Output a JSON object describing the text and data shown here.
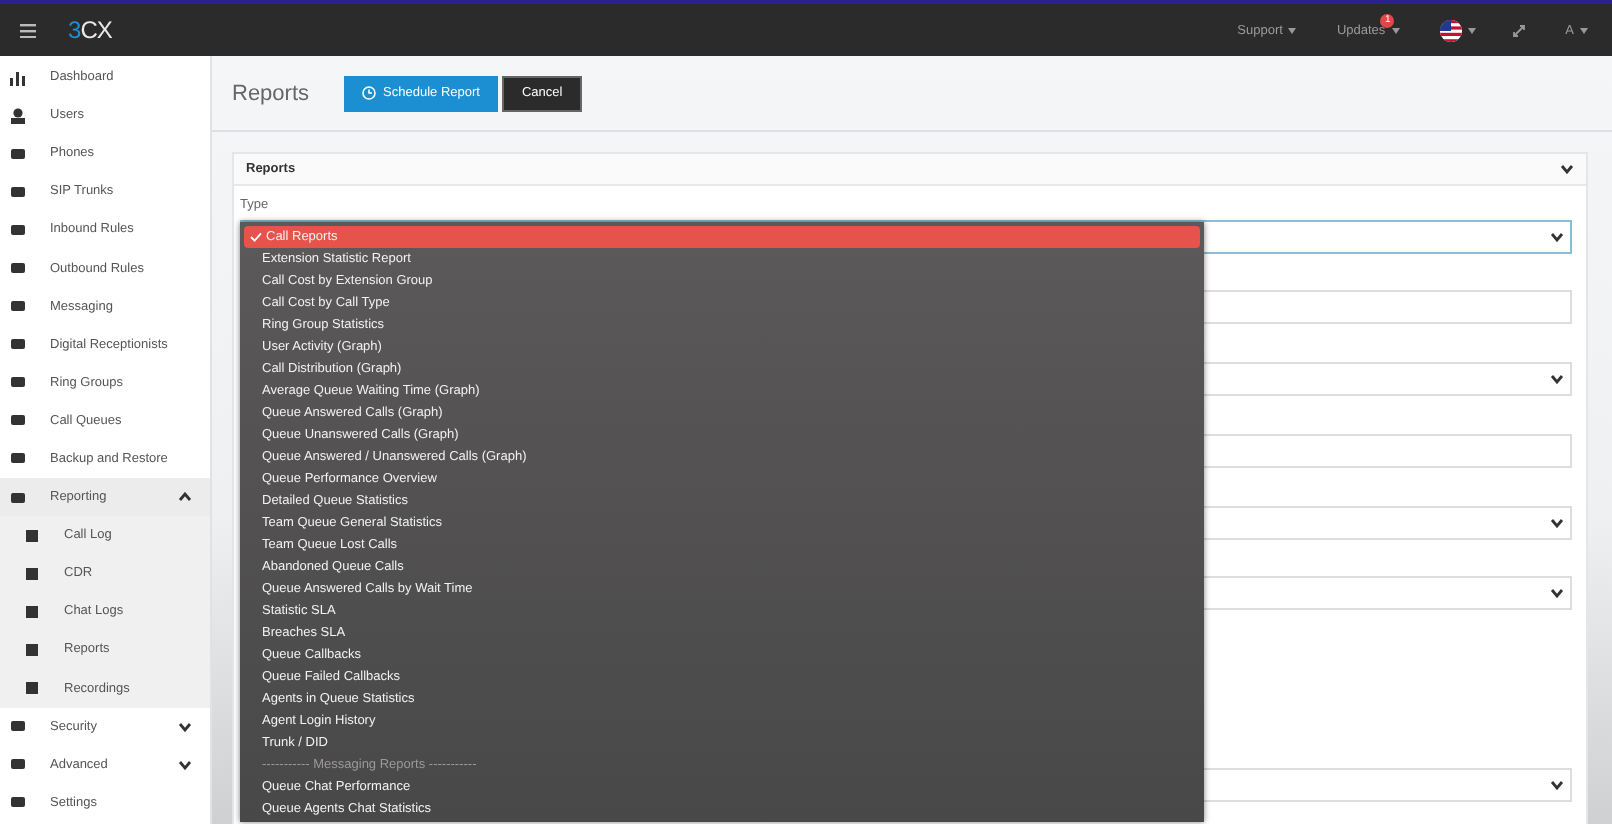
{
  "topbar": {
    "logo": {
      "mark": "3",
      "text": "CX"
    },
    "menus": [
      {
        "label": "Support"
      },
      {
        "label": "Updates",
        "badge": "1"
      }
    ],
    "user": "A"
  },
  "sidebar": {
    "items": [
      {
        "label": "Dashboard",
        "selected": false
      },
      {
        "label": "Users",
        "selected": false
      },
      {
        "label": "Phones",
        "selected": false
      },
      {
        "label": "SIP Trunks",
        "selected": false
      },
      {
        "label": "Inbound Rules",
        "selected": false
      },
      {
        "label": "Outbound Rules",
        "selected": false
      },
      {
        "label": "Messaging",
        "selected": false
      },
      {
        "label": "Digital Receptionists",
        "selected": false
      },
      {
        "label": "Ring Groups",
        "selected": false
      },
      {
        "label": "Call Queues",
        "selected": false
      },
      {
        "label": "Backup and Restore",
        "selected": false
      },
      {
        "label": "Reporting",
        "expanded": true,
        "selected": true,
        "children": [
          {
            "label": "Call Log"
          },
          {
            "label": "CDR"
          },
          {
            "label": "Chat Logs"
          },
          {
            "label": "Reports"
          },
          {
            "label": "Recordings"
          }
        ]
      },
      {
        "label": "Security",
        "expanded": false,
        "selected": false
      },
      {
        "label": "Advanced",
        "expanded": false,
        "selected": false
      },
      {
        "label": "Settings",
        "selected": false
      }
    ]
  },
  "page": {
    "title": "Reports",
    "buttons": [
      {
        "label": "Schedule Report",
        "kind": "primary"
      },
      {
        "label": "Cancel",
        "kind": "secondary"
      }
    ]
  },
  "card": {
    "title": "Reports",
    "type_label": "Type",
    "fields": [
      {
        "kind": "input"
      },
      {
        "kind": "select"
      },
      {
        "kind": "input"
      },
      {
        "kind": "select"
      },
      {
        "kind": "select"
      },
      {
        "kind": "select"
      }
    ],
    "dropdown": {
      "options": [
        {
          "label": "Call Reports",
          "kind": "option",
          "selected": true
        },
        {
          "label": "Extension Statistic Report",
          "kind": "option",
          "selected": false
        },
        {
          "label": "Call Cost by Extension Group",
          "kind": "option",
          "selected": false
        },
        {
          "label": "Call Cost by Call Type",
          "kind": "option",
          "selected": false
        },
        {
          "label": "Ring Group Statistics",
          "kind": "option",
          "selected": false
        },
        {
          "label": "User Activity (Graph)",
          "kind": "option",
          "selected": false
        },
        {
          "label": "Call Distribution (Graph)",
          "kind": "option",
          "selected": false
        },
        {
          "label": "Average Queue Waiting Time (Graph)",
          "kind": "option",
          "selected": false
        },
        {
          "label": "Queue Answered Calls (Graph)",
          "kind": "option",
          "selected": false
        },
        {
          "label": "Queue Unanswered Calls (Graph)",
          "kind": "option",
          "selected": false
        },
        {
          "label": "Queue Answered / Unanswered Calls (Graph)",
          "kind": "option",
          "selected": false
        },
        {
          "label": "Queue Performance Overview",
          "kind": "option",
          "selected": false
        },
        {
          "label": "Detailed Queue Statistics",
          "kind": "option",
          "selected": false
        },
        {
          "label": "Team Queue General Statistics",
          "kind": "option",
          "selected": false
        },
        {
          "label": "Team Queue Lost Calls",
          "kind": "option",
          "selected": false
        },
        {
          "label": "Abandoned Queue Calls",
          "kind": "option",
          "selected": false
        },
        {
          "label": "Queue Answered Calls by Wait Time",
          "kind": "option",
          "selected": false
        },
        {
          "label": "Statistic SLA",
          "kind": "option",
          "selected": false
        },
        {
          "label": "Breaches SLA",
          "kind": "option",
          "selected": false
        },
        {
          "label": "Queue Callbacks",
          "kind": "option",
          "selected": false
        },
        {
          "label": "Queue Failed Callbacks",
          "kind": "option",
          "selected": false
        },
        {
          "label": "Agents in Queue Statistics",
          "kind": "option",
          "selected": false
        },
        {
          "label": "Agent Login History",
          "kind": "option",
          "selected": false
        },
        {
          "label": "Trunk / DID",
          "kind": "option",
          "selected": false
        },
        {
          "label": "----------- Messaging Reports -----------",
          "kind": "header"
        },
        {
          "label": "Queue Chat Performance",
          "kind": "option",
          "selected": false
        },
        {
          "label": "Queue Agents Chat Statistics",
          "kind": "option",
          "selected": false
        }
      ]
    }
  }
}
